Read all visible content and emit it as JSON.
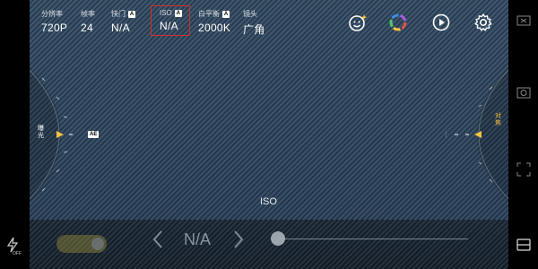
{
  "params": [
    {
      "label": "分辨率",
      "value": "720P",
      "badge": ""
    },
    {
      "label": "帧率",
      "value": "24",
      "badge": ""
    },
    {
      "label": "快门",
      "value": "N/A",
      "badge": "A"
    },
    {
      "label": "ISO",
      "value": "N/A",
      "badge": "A"
    },
    {
      "label": "白平衡",
      "value": "2000K",
      "badge": "A"
    },
    {
      "label": "镜头",
      "value": "广角",
      "badge": ""
    }
  ],
  "dial_left": {
    "label": "曝光",
    "mode": "AE"
  },
  "dial_right": {
    "label": "对焦"
  },
  "mode_label": "ISO",
  "bottom": {
    "value": "N/A",
    "slider": 0.0
  },
  "flash": {
    "state": "OFF"
  },
  "icons": [
    "face-icon",
    "color-icon",
    "play-icon",
    "settings-icon"
  ],
  "colors": {
    "accent": "#f5c242",
    "selected_border": "#d62d2d"
  }
}
